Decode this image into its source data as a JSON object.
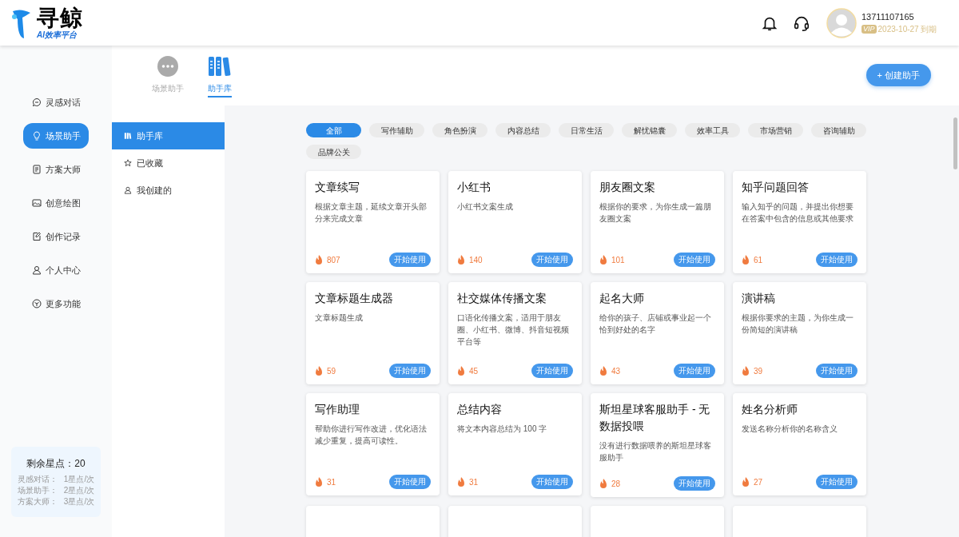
{
  "header": {
    "logo_title": "寻鲸",
    "logo_subtitle": "AI效率平台",
    "user": {
      "phone": "13711107165",
      "vip_badge": "VIP",
      "expiry": "2023-10-27 到期"
    }
  },
  "sidebar": {
    "items": [
      {
        "label": "灵感对话",
        "selected": false
      },
      {
        "label": "场景助手",
        "selected": true
      },
      {
        "label": "方案大师",
        "selected": false
      },
      {
        "label": "创意绘图",
        "selected": false
      },
      {
        "label": "创作记录",
        "selected": false
      },
      {
        "label": "个人中心",
        "selected": false
      },
      {
        "label": "更多功能",
        "selected": false
      }
    ],
    "points": {
      "title": "剩余星点：20",
      "lines": [
        {
          "label": "灵感对话：",
          "value": "1星点/次"
        },
        {
          "label": "场景助手：",
          "value": "2星点/次"
        },
        {
          "label": "方案大师：",
          "value": "3星点/次"
        }
      ]
    }
  },
  "top_tabs": [
    {
      "label": "场景助手",
      "selected": false
    },
    {
      "label": "助手库",
      "selected": true
    }
  ],
  "create_button": "+ 创建助手",
  "submenu": [
    {
      "label": "助手库",
      "selected": true
    },
    {
      "label": "已收藏",
      "selected": false
    },
    {
      "label": "我创建的",
      "selected": false
    }
  ],
  "categories": [
    {
      "label": "全部",
      "selected": true
    },
    {
      "label": "写作辅助",
      "selected": false
    },
    {
      "label": "角色扮演",
      "selected": false
    },
    {
      "label": "内容总结",
      "selected": false
    },
    {
      "label": "日常生活",
      "selected": false
    },
    {
      "label": "解忧锦囊",
      "selected": false
    },
    {
      "label": "效率工具",
      "selected": false
    },
    {
      "label": "市场营销",
      "selected": false
    },
    {
      "label": "咨询辅助",
      "selected": false
    },
    {
      "label": "品牌公关",
      "selected": false
    }
  ],
  "cards": [
    {
      "title": "文章续写",
      "description": "根据文章主题，延续文章开头部分来完成文章",
      "count": "807",
      "button": "开始使用"
    },
    {
      "title": "小红书",
      "description": "小红书文案生成",
      "count": "140",
      "button": "开始使用"
    },
    {
      "title": "朋友圈文案",
      "description": "根据你的要求，为你生成一篇朋友圈文案",
      "count": "101",
      "button": "开始使用"
    },
    {
      "title": "知乎问题回答",
      "description": "输入知乎的问题，并提出你想要在答案中包含的信息或其他要求",
      "count": "61",
      "button": "开始使用"
    },
    {
      "title": "文章标题生成器",
      "description": "文章标题生成",
      "count": "59",
      "button": "开始使用"
    },
    {
      "title": "社交媒体传播文案",
      "description": "口语化传播文案，适用于朋友圈、小红书、微博、抖音短视频平台等",
      "count": "45",
      "button": "开始使用"
    },
    {
      "title": "起名大师",
      "description": "给你的孩子、店铺或事业起一个恰到好处的名字",
      "count": "43",
      "button": "开始使用"
    },
    {
      "title": "演讲稿",
      "description": "根据你要求的主题，为你生成一份简短的演讲稿",
      "count": "39",
      "button": "开始使用"
    },
    {
      "title": "写作助理",
      "description": "帮助你进行写作改进，优化语法减少重复，提高可读性。",
      "count": "31",
      "button": "开始使用"
    },
    {
      "title": "总结内容",
      "description": "将文本内容总结为 100 字",
      "count": "31",
      "button": "开始使用"
    },
    {
      "title": "斯坦星球客服助手 - 无数据投喂",
      "description": "没有进行数据喂养的斯坦星球客服助手",
      "count": "28",
      "button": "开始使用"
    },
    {
      "title": "姓名分析师",
      "description": "发送名称分析你的名称含义",
      "count": "27",
      "button": "开始使用"
    }
  ]
}
